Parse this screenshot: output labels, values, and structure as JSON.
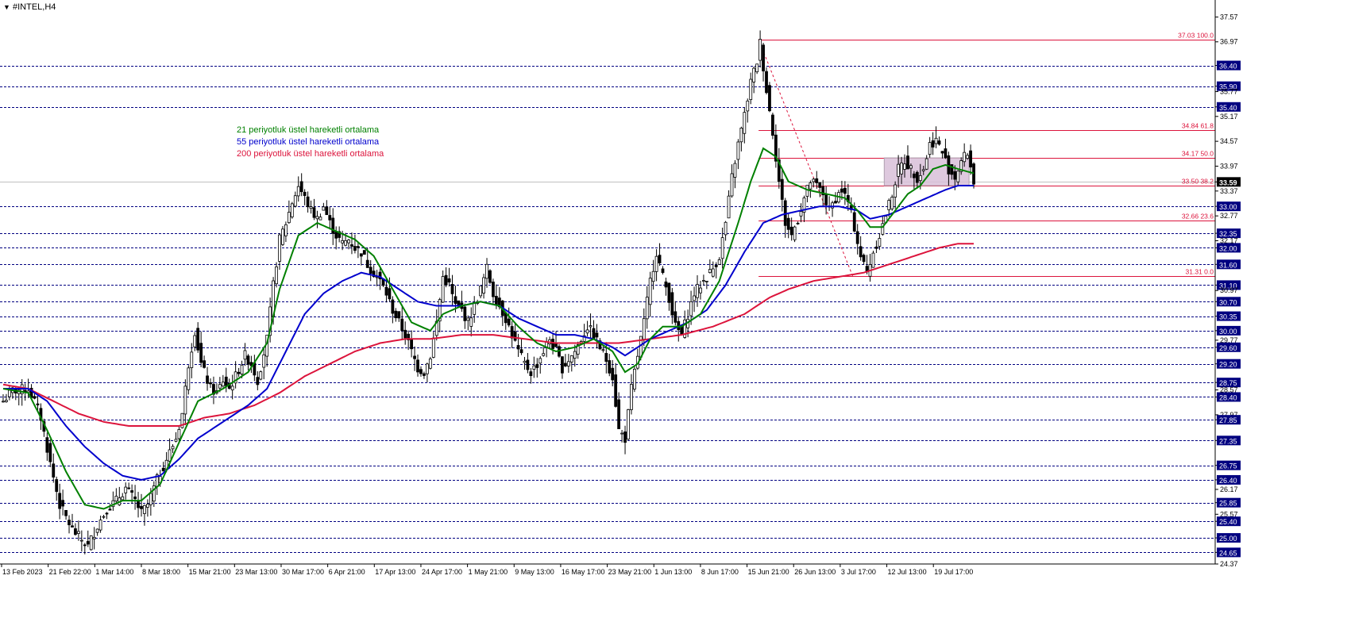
{
  "symbol_title": "#INTEL,H4",
  "legend": [
    {
      "label": "21 periyotluk üstel hareketli ortalama",
      "color": "#008000"
    },
    {
      "label": "55 periyotluk üstel hareketli ortalama",
      "color": "#0000cd"
    },
    {
      "label": "200 periyotluk üstel hareketli ortalama",
      "color": "#dc143c"
    }
  ],
  "colors": {
    "candle": "#000000",
    "grid": "#000080",
    "ema21": "#008000",
    "ema55": "#0000cd",
    "ema200": "#dc143c",
    "fib": "#dc143c",
    "box": "#d8bfd8",
    "current_price_bg": "#000000"
  },
  "chart_data": {
    "type": "candlestick",
    "ylim": [
      24.37,
      37.75
    ],
    "y_ticks": [
      "37.57",
      "36.97",
      "36.40",
      "35.90",
      "35.77",
      "35.40",
      "35.17",
      "34.57",
      "33.97",
      "33.59",
      "33.37",
      "33.00",
      "32.77",
      "32.35",
      "32.17",
      "32.00",
      "31.60",
      "31.10",
      "30.97",
      "30.70",
      "30.35",
      "30.00",
      "29.77",
      "29.60",
      "29.20",
      "28.75",
      "28.57",
      "28.40",
      "27.97",
      "27.85",
      "27.35",
      "26.75",
      "26.40",
      "26.17",
      "25.85",
      "25.57",
      "25.40",
      "25.00",
      "24.65",
      "24.37"
    ],
    "highlighted_y_ticks": [
      "36.40",
      "35.90",
      "35.40",
      "33.59",
      "33.00",
      "32.35",
      "32.00",
      "31.60",
      "31.10",
      "30.70",
      "30.35",
      "30.00",
      "29.60",
      "29.20",
      "28.75",
      "28.40",
      "27.85",
      "27.35",
      "26.75",
      "26.40",
      "25.85",
      "25.40",
      "25.00",
      "24.65"
    ],
    "horizontal_levels": [
      36.4,
      35.9,
      35.4,
      33.0,
      32.35,
      32.0,
      31.6,
      31.1,
      30.7,
      30.35,
      30.0,
      29.6,
      29.2,
      28.75,
      28.4,
      27.85,
      27.35,
      26.75,
      26.4,
      25.85,
      25.4,
      25.0,
      24.65
    ],
    "current_price": "33.59",
    "x_labels": [
      "13 Feb 2023",
      "21 Feb 22:00",
      "1 Mar 14:00",
      "8 Mar 18:00",
      "15 Mar 21:00",
      "23 Mar 13:00",
      "30 Mar 17:00",
      "6 Apr 21:00",
      "17 Apr 13:00",
      "24 Apr 17:00",
      "1 May 21:00",
      "9 May 13:00",
      "16 May 17:00",
      "23 May 21:00",
      "1 Jun 13:00",
      "8 Jun 17:00",
      "15 Jun 21:00",
      "26 Jun 13:00",
      "3 Jul 17:00",
      "12 Jul 13:00",
      "19 Jul 17:00"
    ],
    "fibonacci": [
      {
        "label": "37.03 100.0",
        "price": 37.03
      },
      {
        "label": "34.84 61.8",
        "price": 34.84
      },
      {
        "label": "34.17 50.0",
        "price": 34.17
      },
      {
        "label": "33.50 38.2",
        "price": 33.5
      },
      {
        "label": "32.66 23.6",
        "price": 32.66
      },
      {
        "label": "31.31 0.0",
        "price": 31.31
      }
    ],
    "close_path": [
      [
        0,
        28.3
      ],
      [
        3,
        28.55
      ],
      [
        8,
        28.6
      ],
      [
        10,
        28.3
      ],
      [
        12,
        27.9
      ],
      [
        15,
        26.8
      ],
      [
        18,
        25.8
      ],
      [
        22,
        25.2
      ],
      [
        25,
        24.95
      ],
      [
        27,
        24.8
      ],
      [
        30,
        25.3
      ],
      [
        33,
        25.7
      ],
      [
        36,
        25.9
      ],
      [
        39,
        26.2
      ],
      [
        42,
        25.9
      ],
      [
        44,
        25.6
      ],
      [
        46,
        25.8
      ],
      [
        49,
        26.4
      ],
      [
        52,
        26.9
      ],
      [
        55,
        27.4
      ],
      [
        57,
        28.0
      ],
      [
        59,
        29.2
      ],
      [
        61,
        30.0
      ],
      [
        63,
        29.2
      ],
      [
        66,
        28.6
      ],
      [
        68,
        28.5
      ],
      [
        70,
        28.8
      ],
      [
        72,
        28.6
      ],
      [
        74,
        28.9
      ],
      [
        77,
        29.4
      ],
      [
        79,
        29.2
      ],
      [
        81,
        28.8
      ],
      [
        84,
        29.8
      ],
      [
        86,
        31.1
      ],
      [
        88,
        32.2
      ],
      [
        90,
        32.6
      ],
      [
        92,
        33.1
      ],
      [
        94,
        33.5
      ],
      [
        96,
        33.2
      ],
      [
        98,
        32.9
      ],
      [
        100,
        32.7
      ],
      [
        102,
        33.0
      ],
      [
        104,
        32.6
      ],
      [
        106,
        32.3
      ],
      [
        108,
        32.1
      ],
      [
        110,
        32.2
      ],
      [
        112,
        32.0
      ],
      [
        114,
        31.9
      ],
      [
        116,
        31.6
      ],
      [
        118,
        31.4
      ],
      [
        120,
        31.2
      ],
      [
        122,
        30.9
      ],
      [
        124,
        30.5
      ],
      [
        126,
        30.2
      ],
      [
        128,
        29.9
      ],
      [
        130,
        29.5
      ],
      [
        132,
        29.1
      ],
      [
        134,
        29.0
      ],
      [
        136,
        29.4
      ],
      [
        138,
        30.2
      ],
      [
        140,
        31.3
      ],
      [
        142,
        31.1
      ],
      [
        144,
        30.6
      ],
      [
        146,
        30.5
      ],
      [
        148,
        30.2
      ],
      [
        150,
        30.6
      ],
      [
        152,
        31.0
      ],
      [
        154,
        31.5
      ],
      [
        156,
        30.9
      ],
      [
        158,
        30.6
      ],
      [
        160,
        30.3
      ],
      [
        162,
        29.9
      ],
      [
        164,
        29.5
      ],
      [
        166,
        29.2
      ],
      [
        168,
        29.0
      ],
      [
        170,
        29.2
      ],
      [
        172,
        29.5
      ],
      [
        174,
        29.8
      ],
      [
        176,
        29.5
      ],
      [
        178,
        29.1
      ],
      [
        180,
        29.3
      ],
      [
        182,
        29.5
      ],
      [
        184,
        29.8
      ],
      [
        186,
        30.1
      ],
      [
        188,
        29.9
      ],
      [
        190,
        29.6
      ],
      [
        192,
        29.3
      ],
      [
        194,
        28.9
      ],
      [
        196,
        27.6
      ],
      [
        198,
        27.4
      ],
      [
        200,
        28.6
      ],
      [
        202,
        29.4
      ],
      [
        204,
        30.2
      ],
      [
        206,
        31.2
      ],
      [
        208,
        31.9
      ],
      [
        210,
        31.3
      ],
      [
        212,
        30.8
      ],
      [
        214,
        30.1
      ],
      [
        216,
        29.9
      ],
      [
        218,
        30.4
      ],
      [
        220,
        30.9
      ],
      [
        222,
        31.1
      ],
      [
        224,
        31.3
      ],
      [
        226,
        31.5
      ],
      [
        228,
        31.8
      ],
      [
        230,
        32.6
      ],
      [
        232,
        33.7
      ],
      [
        234,
        34.5
      ],
      [
        236,
        35.2
      ],
      [
        238,
        36.0
      ],
      [
        240,
        36.5
      ],
      [
        241,
        36.95
      ],
      [
        243,
        35.8
      ],
      [
        245,
        34.8
      ],
      [
        247,
        33.6
      ],
      [
        249,
        32.6
      ],
      [
        251,
        32.3
      ],
      [
        253,
        32.7
      ],
      [
        255,
        33.2
      ],
      [
        257,
        33.6
      ],
      [
        259,
        33.5
      ],
      [
        261,
        33.3
      ],
      [
        263,
        32.9
      ],
      [
        265,
        33.2
      ],
      [
        267,
        33.4
      ],
      [
        269,
        33.1
      ],
      [
        271,
        32.5
      ],
      [
        273,
        31.8
      ],
      [
        275,
        31.4
      ],
      [
        277,
        31.9
      ],
      [
        279,
        32.3
      ],
      [
        281,
        32.8
      ],
      [
        283,
        33.3
      ],
      [
        285,
        33.9
      ],
      [
        287,
        34.1
      ],
      [
        289,
        33.9
      ],
      [
        291,
        33.7
      ],
      [
        293,
        33.9
      ],
      [
        295,
        34.5
      ],
      [
        297,
        34.6
      ],
      [
        299,
        34.3
      ],
      [
        301,
        33.9
      ],
      [
        303,
        33.7
      ],
      [
        305,
        34.1
      ],
      [
        307,
        34.3
      ],
      [
        309,
        33.6
      ]
    ],
    "ema21_path": [
      [
        0,
        28.6
      ],
      [
        8,
        28.5
      ],
      [
        14,
        27.6
      ],
      [
        20,
        26.6
      ],
      [
        26,
        25.8
      ],
      [
        32,
        25.7
      ],
      [
        38,
        25.9
      ],
      [
        44,
        25.9
      ],
      [
        50,
        26.3
      ],
      [
        56,
        27.3
      ],
      [
        62,
        28.3
      ],
      [
        70,
        28.6
      ],
      [
        78,
        29.0
      ],
      [
        84,
        29.7
      ],
      [
        88,
        31.0
      ],
      [
        94,
        32.3
      ],
      [
        100,
        32.6
      ],
      [
        106,
        32.4
      ],
      [
        112,
        32.2
      ],
      [
        118,
        31.8
      ],
      [
        124,
        31.0
      ],
      [
        130,
        30.2
      ],
      [
        136,
        30.0
      ],
      [
        140,
        30.4
      ],
      [
        146,
        30.6
      ],
      [
        152,
        30.7
      ],
      [
        158,
        30.6
      ],
      [
        164,
        30.1
      ],
      [
        170,
        29.7
      ],
      [
        176,
        29.5
      ],
      [
        182,
        29.6
      ],
      [
        188,
        29.8
      ],
      [
        194,
        29.5
      ],
      [
        198,
        29.0
      ],
      [
        202,
        29.2
      ],
      [
        206,
        29.8
      ],
      [
        210,
        30.1
      ],
      [
        216,
        30.1
      ],
      [
        222,
        30.4
      ],
      [
        228,
        31.2
      ],
      [
        234,
        32.6
      ],
      [
        238,
        33.6
      ],
      [
        242,
        34.4
      ],
      [
        246,
        34.2
      ],
      [
        250,
        33.6
      ],
      [
        256,
        33.4
      ],
      [
        262,
        33.3
      ],
      [
        268,
        33.2
      ],
      [
        272,
        32.9
      ],
      [
        276,
        32.5
      ],
      [
        280,
        32.5
      ],
      [
        284,
        32.9
      ],
      [
        288,
        33.3
      ],
      [
        292,
        33.5
      ],
      [
        296,
        33.9
      ],
      [
        300,
        34.0
      ],
      [
        304,
        33.9
      ],
      [
        309,
        33.8
      ]
    ],
    "ema55_path": [
      [
        0,
        28.6
      ],
      [
        8,
        28.6
      ],
      [
        14,
        28.3
      ],
      [
        20,
        27.7
      ],
      [
        26,
        27.2
      ],
      [
        32,
        26.8
      ],
      [
        38,
        26.5
      ],
      [
        44,
        26.4
      ],
      [
        50,
        26.5
      ],
      [
        56,
        26.9
      ],
      [
        62,
        27.4
      ],
      [
        70,
        27.8
      ],
      [
        78,
        28.2
      ],
      [
        84,
        28.6
      ],
      [
        90,
        29.5
      ],
      [
        96,
        30.4
      ],
      [
        102,
        30.9
      ],
      [
        108,
        31.2
      ],
      [
        114,
        31.4
      ],
      [
        120,
        31.3
      ],
      [
        126,
        31.0
      ],
      [
        132,
        30.7
      ],
      [
        138,
        30.6
      ],
      [
        146,
        30.6
      ],
      [
        152,
        30.7
      ],
      [
        158,
        30.6
      ],
      [
        164,
        30.3
      ],
      [
        170,
        30.1
      ],
      [
        176,
        29.9
      ],
      [
        182,
        29.9
      ],
      [
        188,
        29.8
      ],
      [
        194,
        29.6
      ],
      [
        198,
        29.4
      ],
      [
        202,
        29.6
      ],
      [
        206,
        29.8
      ],
      [
        212,
        30.0
      ],
      [
        218,
        30.2
      ],
      [
        224,
        30.5
      ],
      [
        230,
        31.1
      ],
      [
        236,
        31.9
      ],
      [
        242,
        32.6
      ],
      [
        248,
        32.8
      ],
      [
        254,
        32.9
      ],
      [
        260,
        33.0
      ],
      [
        266,
        33.0
      ],
      [
        272,
        32.9
      ],
      [
        276,
        32.7
      ],
      [
        282,
        32.8
      ],
      [
        288,
        33.0
      ],
      [
        294,
        33.2
      ],
      [
        300,
        33.4
      ],
      [
        304,
        33.5
      ],
      [
        309,
        33.5
      ]
    ],
    "ema200_path": [
      [
        0,
        28.7
      ],
      [
        8,
        28.6
      ],
      [
        16,
        28.3
      ],
      [
        24,
        28.0
      ],
      [
        32,
        27.8
      ],
      [
        40,
        27.7
      ],
      [
        48,
        27.7
      ],
      [
        56,
        27.7
      ],
      [
        64,
        27.9
      ],
      [
        72,
        28.0
      ],
      [
        80,
        28.2
      ],
      [
        88,
        28.5
      ],
      [
        96,
        28.9
      ],
      [
        104,
        29.2
      ],
      [
        112,
        29.5
      ],
      [
        120,
        29.7
      ],
      [
        128,
        29.8
      ],
      [
        136,
        29.8
      ],
      [
        146,
        29.9
      ],
      [
        156,
        29.9
      ],
      [
        166,
        29.8
      ],
      [
        176,
        29.7
      ],
      [
        186,
        29.7
      ],
      [
        196,
        29.7
      ],
      [
        206,
        29.8
      ],
      [
        216,
        29.9
      ],
      [
        226,
        30.1
      ],
      [
        236,
        30.4
      ],
      [
        244,
        30.8
      ],
      [
        250,
        31.0
      ],
      [
        258,
        31.2
      ],
      [
        266,
        31.3
      ],
      [
        274,
        31.4
      ],
      [
        282,
        31.6
      ],
      [
        290,
        31.8
      ],
      [
        298,
        32.0
      ],
      [
        304,
        32.1
      ],
      [
        309,
        32.1
      ]
    ],
    "bars": 310
  }
}
